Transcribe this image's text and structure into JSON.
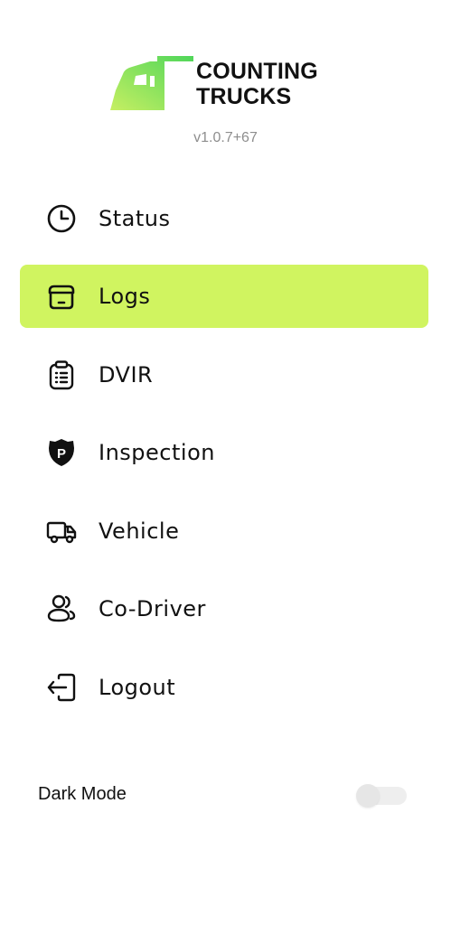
{
  "brand": {
    "line1": "COUNTING",
    "line2": "TRUCKS",
    "version": "v1.0.7+67",
    "accent_color": "#d0f460"
  },
  "menu": {
    "items": [
      {
        "label": "Status",
        "icon": "clock-icon",
        "active": false
      },
      {
        "label": "Logs",
        "icon": "logs-icon",
        "active": true
      },
      {
        "label": "DVIR",
        "icon": "clipboard-icon",
        "active": false
      },
      {
        "label": "Inspection",
        "icon": "police-badge-icon",
        "active": false
      },
      {
        "label": "Vehicle",
        "icon": "truck-icon",
        "active": false
      },
      {
        "label": "Co-Driver",
        "icon": "users-icon",
        "active": false
      },
      {
        "label": "Logout",
        "icon": "logout-icon",
        "active": false
      }
    ]
  },
  "settings": {
    "dark_mode_label": "Dark Mode",
    "dark_mode_enabled": false
  }
}
